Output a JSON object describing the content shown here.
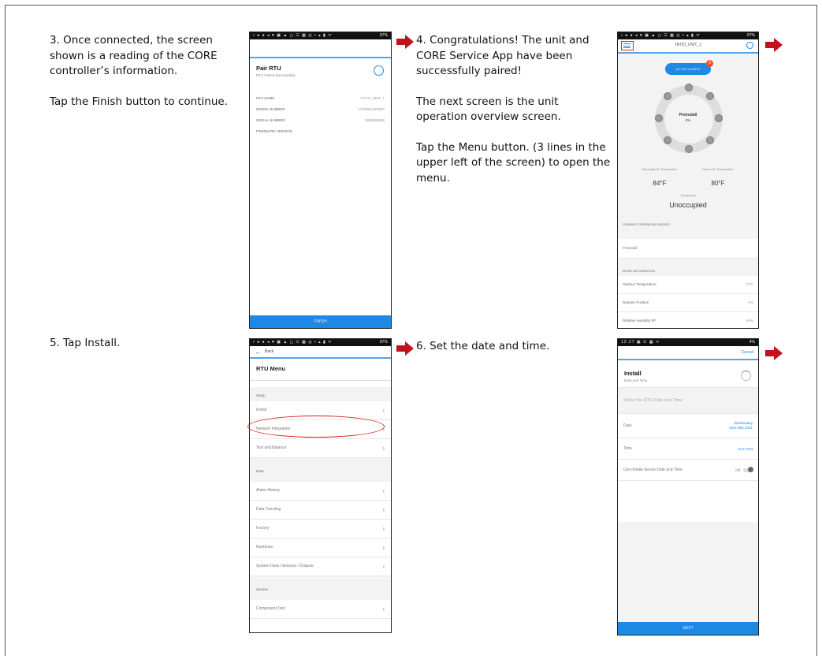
{
  "steps": {
    "s3": {
      "p1": "3. Once connected, the screen shown is a reading of the CORE controller’s information.",
      "p2": "Tap the Finish button to continue."
    },
    "s4": {
      "p1": "4. Congratulations! The unit and CORE Service App have been successfully paired!",
      "p2": "The next screen is the unit operation overview screen.",
      "p3": "Tap the Menu button. (3 lines in the upper left of the screen) to open the menu."
    },
    "s5": {
      "p1": "5. Tap Install."
    },
    "s6": {
      "p1": "6. Set the date and time."
    }
  },
  "colors": {
    "arrow": "#c0121a",
    "accent": "#1e88e5",
    "highlight": "#d22222"
  },
  "screen1": {
    "status_right": "87%",
    "title": "Pair RTU",
    "subtitle": "RTU Paired Successfully",
    "fields": [
      {
        "label": "RTU NAME",
        "value": "TATIO_UNIT_1"
      },
      {
        "label": "MODEL NUMBER",
        "value": "LGH092U4EBR0"
      },
      {
        "label": "SERIAL NUMBER",
        "value": "0808080808"
      },
      {
        "label": "FIRMWARE VERSION",
        "value": ""
      }
    ],
    "button": "FINISH"
  },
  "screen2": {
    "status_right": "87%",
    "title": "TATIO_UNIT_1",
    "alerts_label": "ACTIVE ALERTS",
    "alerts_count": "3",
    "center_title": "Preinstall",
    "center_value": "0%",
    "discharge_label": "Discharge Air Temperature",
    "discharge_value": "84°F",
    "return_label": "Return Air Temperature",
    "return_value": "80°F",
    "occupancy_label": "Occupancy",
    "occupancy_value": "Unoccupied",
    "modes_header": "CURRENT OPERATING MODES",
    "mode": "Preinstall",
    "more_header": "MORE INFORMATION",
    "info": [
      {
        "label": "Outdoor Temperature",
        "value": "72°F"
      },
      {
        "label": "Damper Position",
        "value": "0%"
      },
      {
        "label": "Relative Humidity SP",
        "value": "60%"
      }
    ]
  },
  "screen3": {
    "status_right": "87%",
    "back": "Back",
    "title": "RTU Menu",
    "sections": [
      {
        "name": "Setup",
        "items": [
          "Install",
          "Network Integration",
          "Test and Balance"
        ]
      },
      {
        "name": "Data",
        "items": [
          "Alarm History",
          "Data Trending",
          "Factory",
          "Runtimes",
          "System Data / Sensors / Outputs"
        ]
      },
      {
        "name": "Service",
        "items": [
          "Component Test"
        ]
      }
    ]
  },
  "screen4": {
    "status_left": "12:27",
    "status_right": "4%",
    "cancel": "Cancel",
    "title": "Install",
    "subtitle": "Date and Time",
    "prompt": "Select the RTU Date and Time:",
    "date_label": "Date",
    "date_value_1": "Wednesday",
    "date_value_2": "April 28th 2021",
    "time_label": "Time",
    "time_value": "12:27 PM",
    "toggle_label": "Use mobile device Date and Time",
    "toggle_state": "Off",
    "button": "NEXT"
  }
}
